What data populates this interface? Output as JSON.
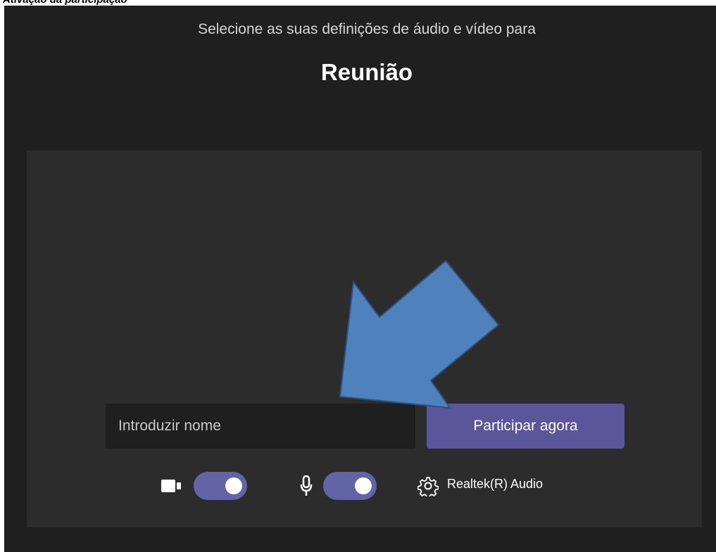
{
  "header_caption": "Ativação da participação",
  "dialog": {
    "subtitle": "Selecione as suas definições de áudio e vídeo para",
    "title": "Reunião"
  },
  "name_input": {
    "placeholder": "Introduzir nome",
    "value": ""
  },
  "join_button": {
    "label": "Participar agora"
  },
  "controls": {
    "camera": {
      "icon": "camera-icon",
      "enabled": true
    },
    "microphone": {
      "icon": "microphone-icon",
      "enabled": true
    },
    "device_settings": {
      "icon": "gear-icon",
      "label": "Realtek(R) Audio"
    }
  },
  "annotation": {
    "icon": "arrow-icon",
    "color": "#4f81bd"
  },
  "colors": {
    "background": "#201f1f",
    "panel": "#2d2c2c",
    "accent": "#5a5699",
    "toggle": "#6264a7"
  }
}
